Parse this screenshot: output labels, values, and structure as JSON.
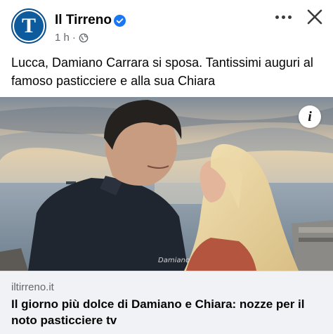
{
  "post": {
    "page_name": "Il Tirreno",
    "time": "1 h",
    "separator": "·",
    "text": "Lucca, Damiano Carrara si sposa. Tantissimi auguri al famoso pasticciere e alla sua Chiara",
    "avatar_letter": "T"
  },
  "icons": {
    "verified": "verified-badge-icon",
    "audience": "globe-icon",
    "more": "more-options-icon",
    "close": "close-icon",
    "info": "info-icon"
  },
  "link": {
    "domain": "iltirreno.it",
    "title": "Il giorno più dolce di Damiano e Chiara: nozze per il noto pasticciere tv"
  },
  "photo": {
    "info_glyph": "i",
    "shirt_signature": "Damiano"
  },
  "colors": {
    "brand_blue": "#0d5a9c",
    "verified_blue": "#1877f2",
    "secondary_text": "#65676b",
    "link_card_bg": "#f0f2f5"
  }
}
